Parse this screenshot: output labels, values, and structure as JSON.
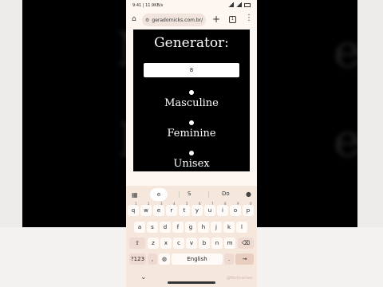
{
  "background": {
    "words": [
      "M",
      "e",
      "F",
      "e"
    ]
  },
  "status": {
    "time": "9:41 | 11.9KB/s",
    "battery": ""
  },
  "browser": {
    "url": "geradornicks.com.br/",
    "tab_count": "1"
  },
  "page": {
    "title": "Generator:",
    "input_value": "8",
    "options": [
      "Masculine",
      "Feminine",
      "Unisex"
    ]
  },
  "keyboard": {
    "suggestions": [
      "e",
      "S",
      "Do"
    ],
    "rows": [
      [
        "q",
        "w",
        "e",
        "r",
        "t",
        "y",
        "u",
        "i",
        "o",
        "p"
      ],
      [
        "a",
        "s",
        "d",
        "f",
        "g",
        "h",
        "j",
        "k",
        "l"
      ],
      [
        "z",
        "x",
        "c",
        "v",
        "b",
        "n",
        "m"
      ]
    ],
    "number_hints": [
      "1",
      "2",
      "3",
      "4",
      "5",
      "6",
      "7",
      "8",
      "9",
      "0"
    ],
    "symbols_key": "?123",
    "comma_key": ",",
    "space_label": "English",
    "period_key": "."
  },
  "watermark": "@Nicknames"
}
